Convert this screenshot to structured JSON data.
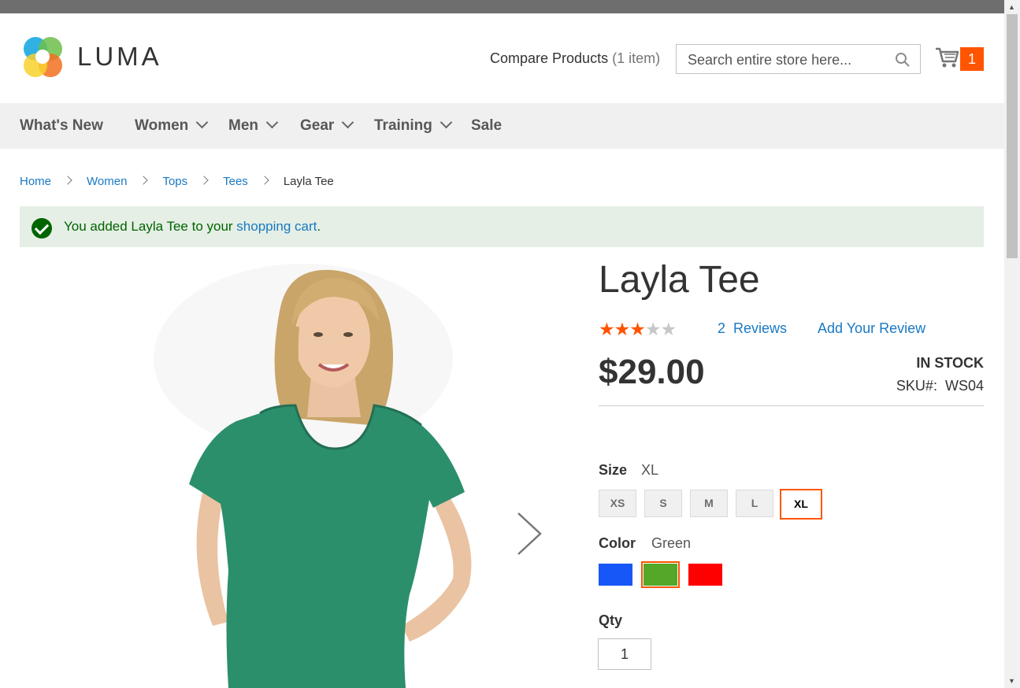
{
  "header": {
    "logo_text": "LUMA",
    "compare_label": "Compare Products",
    "compare_count": "(1 item)",
    "search_placeholder": "Search entire store here...",
    "cart_count": "1"
  },
  "nav": {
    "items": [
      {
        "label": "What's New",
        "has_dropdown": false
      },
      {
        "label": "Women",
        "has_dropdown": true
      },
      {
        "label": "Men",
        "has_dropdown": true
      },
      {
        "label": "Gear",
        "has_dropdown": true
      },
      {
        "label": "Training",
        "has_dropdown": true
      },
      {
        "label": "Sale",
        "has_dropdown": false
      }
    ]
  },
  "breadcrumb": {
    "items": [
      "Home",
      "Women",
      "Tops",
      "Tees"
    ],
    "current": "Layla Tee"
  },
  "message": {
    "text_before": "You added Layla Tee to your ",
    "link": "shopping cart",
    "text_after": "."
  },
  "product": {
    "name": "Layla Tee",
    "rating_stars": 3,
    "rating_max": 5,
    "reviews_count": "2",
    "reviews_label": "Reviews",
    "add_review": "Add Your Review",
    "price": "$29.00",
    "stock": "IN STOCK",
    "sku_label": "SKU#:",
    "sku": "WS04"
  },
  "options": {
    "size_label": "Size",
    "size_selected": "XL",
    "sizes": [
      "XS",
      "S",
      "M",
      "L",
      "XL"
    ],
    "color_label": "Color",
    "color_selected": "Green",
    "colors": [
      {
        "name": "Blue",
        "hex": "#1857f7"
      },
      {
        "name": "Green",
        "hex": "#53a828"
      },
      {
        "name": "Red",
        "hex": "#ff0000"
      }
    ],
    "qty_label": "Qty",
    "qty_value": "1"
  },
  "colors": {
    "accent": "#ff5501",
    "link": "#1979c3",
    "success_bg": "#e5efe5",
    "success_text": "#006400"
  },
  "icons": {
    "search": "search-icon",
    "cart": "cart-icon",
    "next": "chevron-right-icon",
    "success": "check-circle-icon"
  }
}
